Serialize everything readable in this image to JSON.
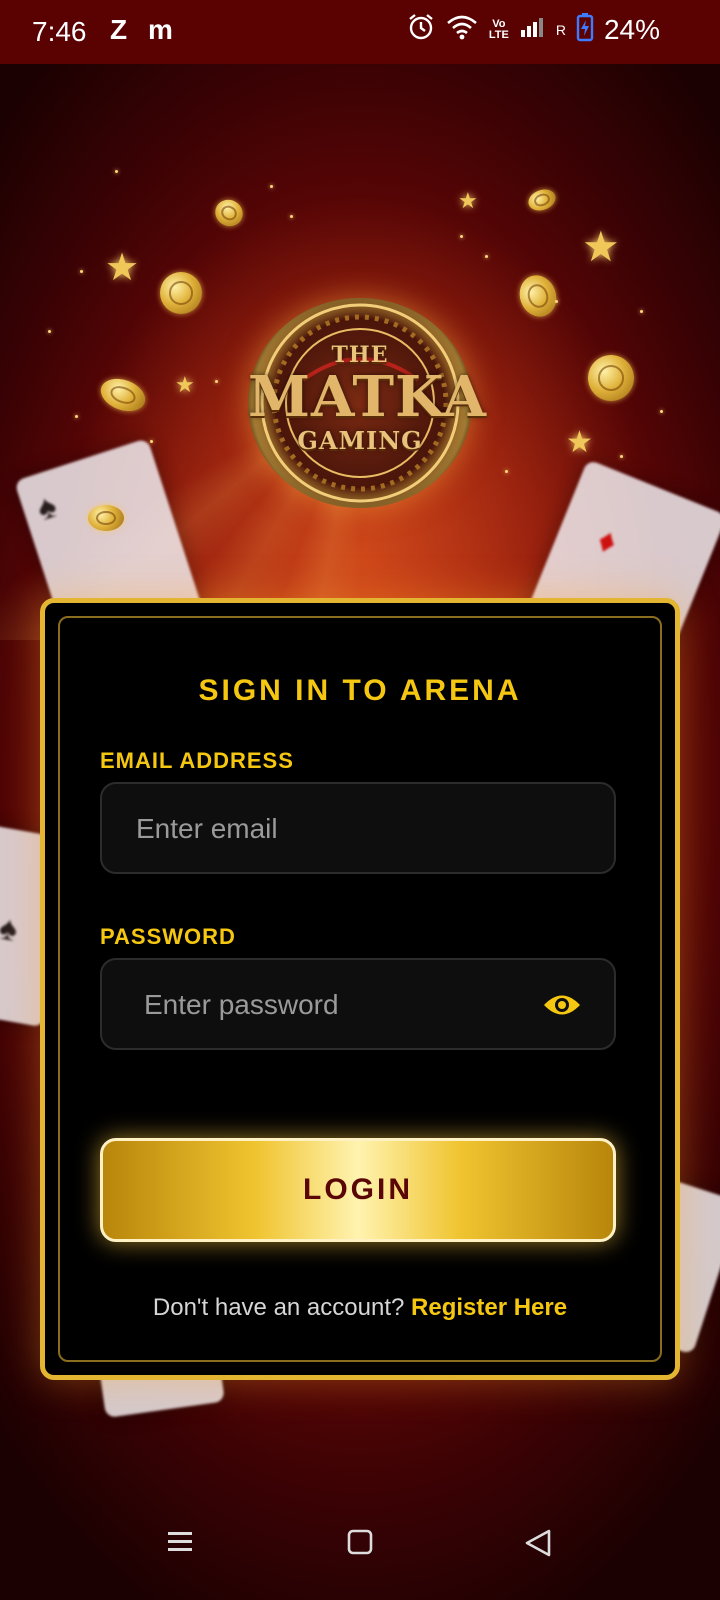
{
  "status_bar": {
    "time": "7:46",
    "app_icons": [
      "Z",
      "m"
    ],
    "battery_percent": "24%",
    "indicators": [
      "alarm-icon",
      "wifi-icon",
      "volte-icon",
      "signal-icon",
      "battery-charging-icon"
    ],
    "volte_label": "Vo LTE",
    "roaming_label": "R"
  },
  "logo": {
    "line1": "THE",
    "line2": "MATKA",
    "line3": "GAMING"
  },
  "login": {
    "title": "SIGN IN TO ARENA",
    "email_label": "EMAIL ADDRESS",
    "email_placeholder": "Enter email",
    "email_value": "",
    "password_label": "PASSWORD",
    "password_placeholder": "Enter password",
    "password_value": "",
    "show_password_icon": "eye-icon",
    "login_button": "LOGIN",
    "register_prompt": "Don't have an account?",
    "register_link": "Register Here"
  },
  "navbar": {
    "buttons": [
      "menu-icon",
      "home-square-icon",
      "back-triangle-icon"
    ]
  },
  "colors": {
    "accent_gold": "#f5c711",
    "panel_border": "#e4b531",
    "background_red": "#8a0c08",
    "status_bar": "#5a0102"
  }
}
